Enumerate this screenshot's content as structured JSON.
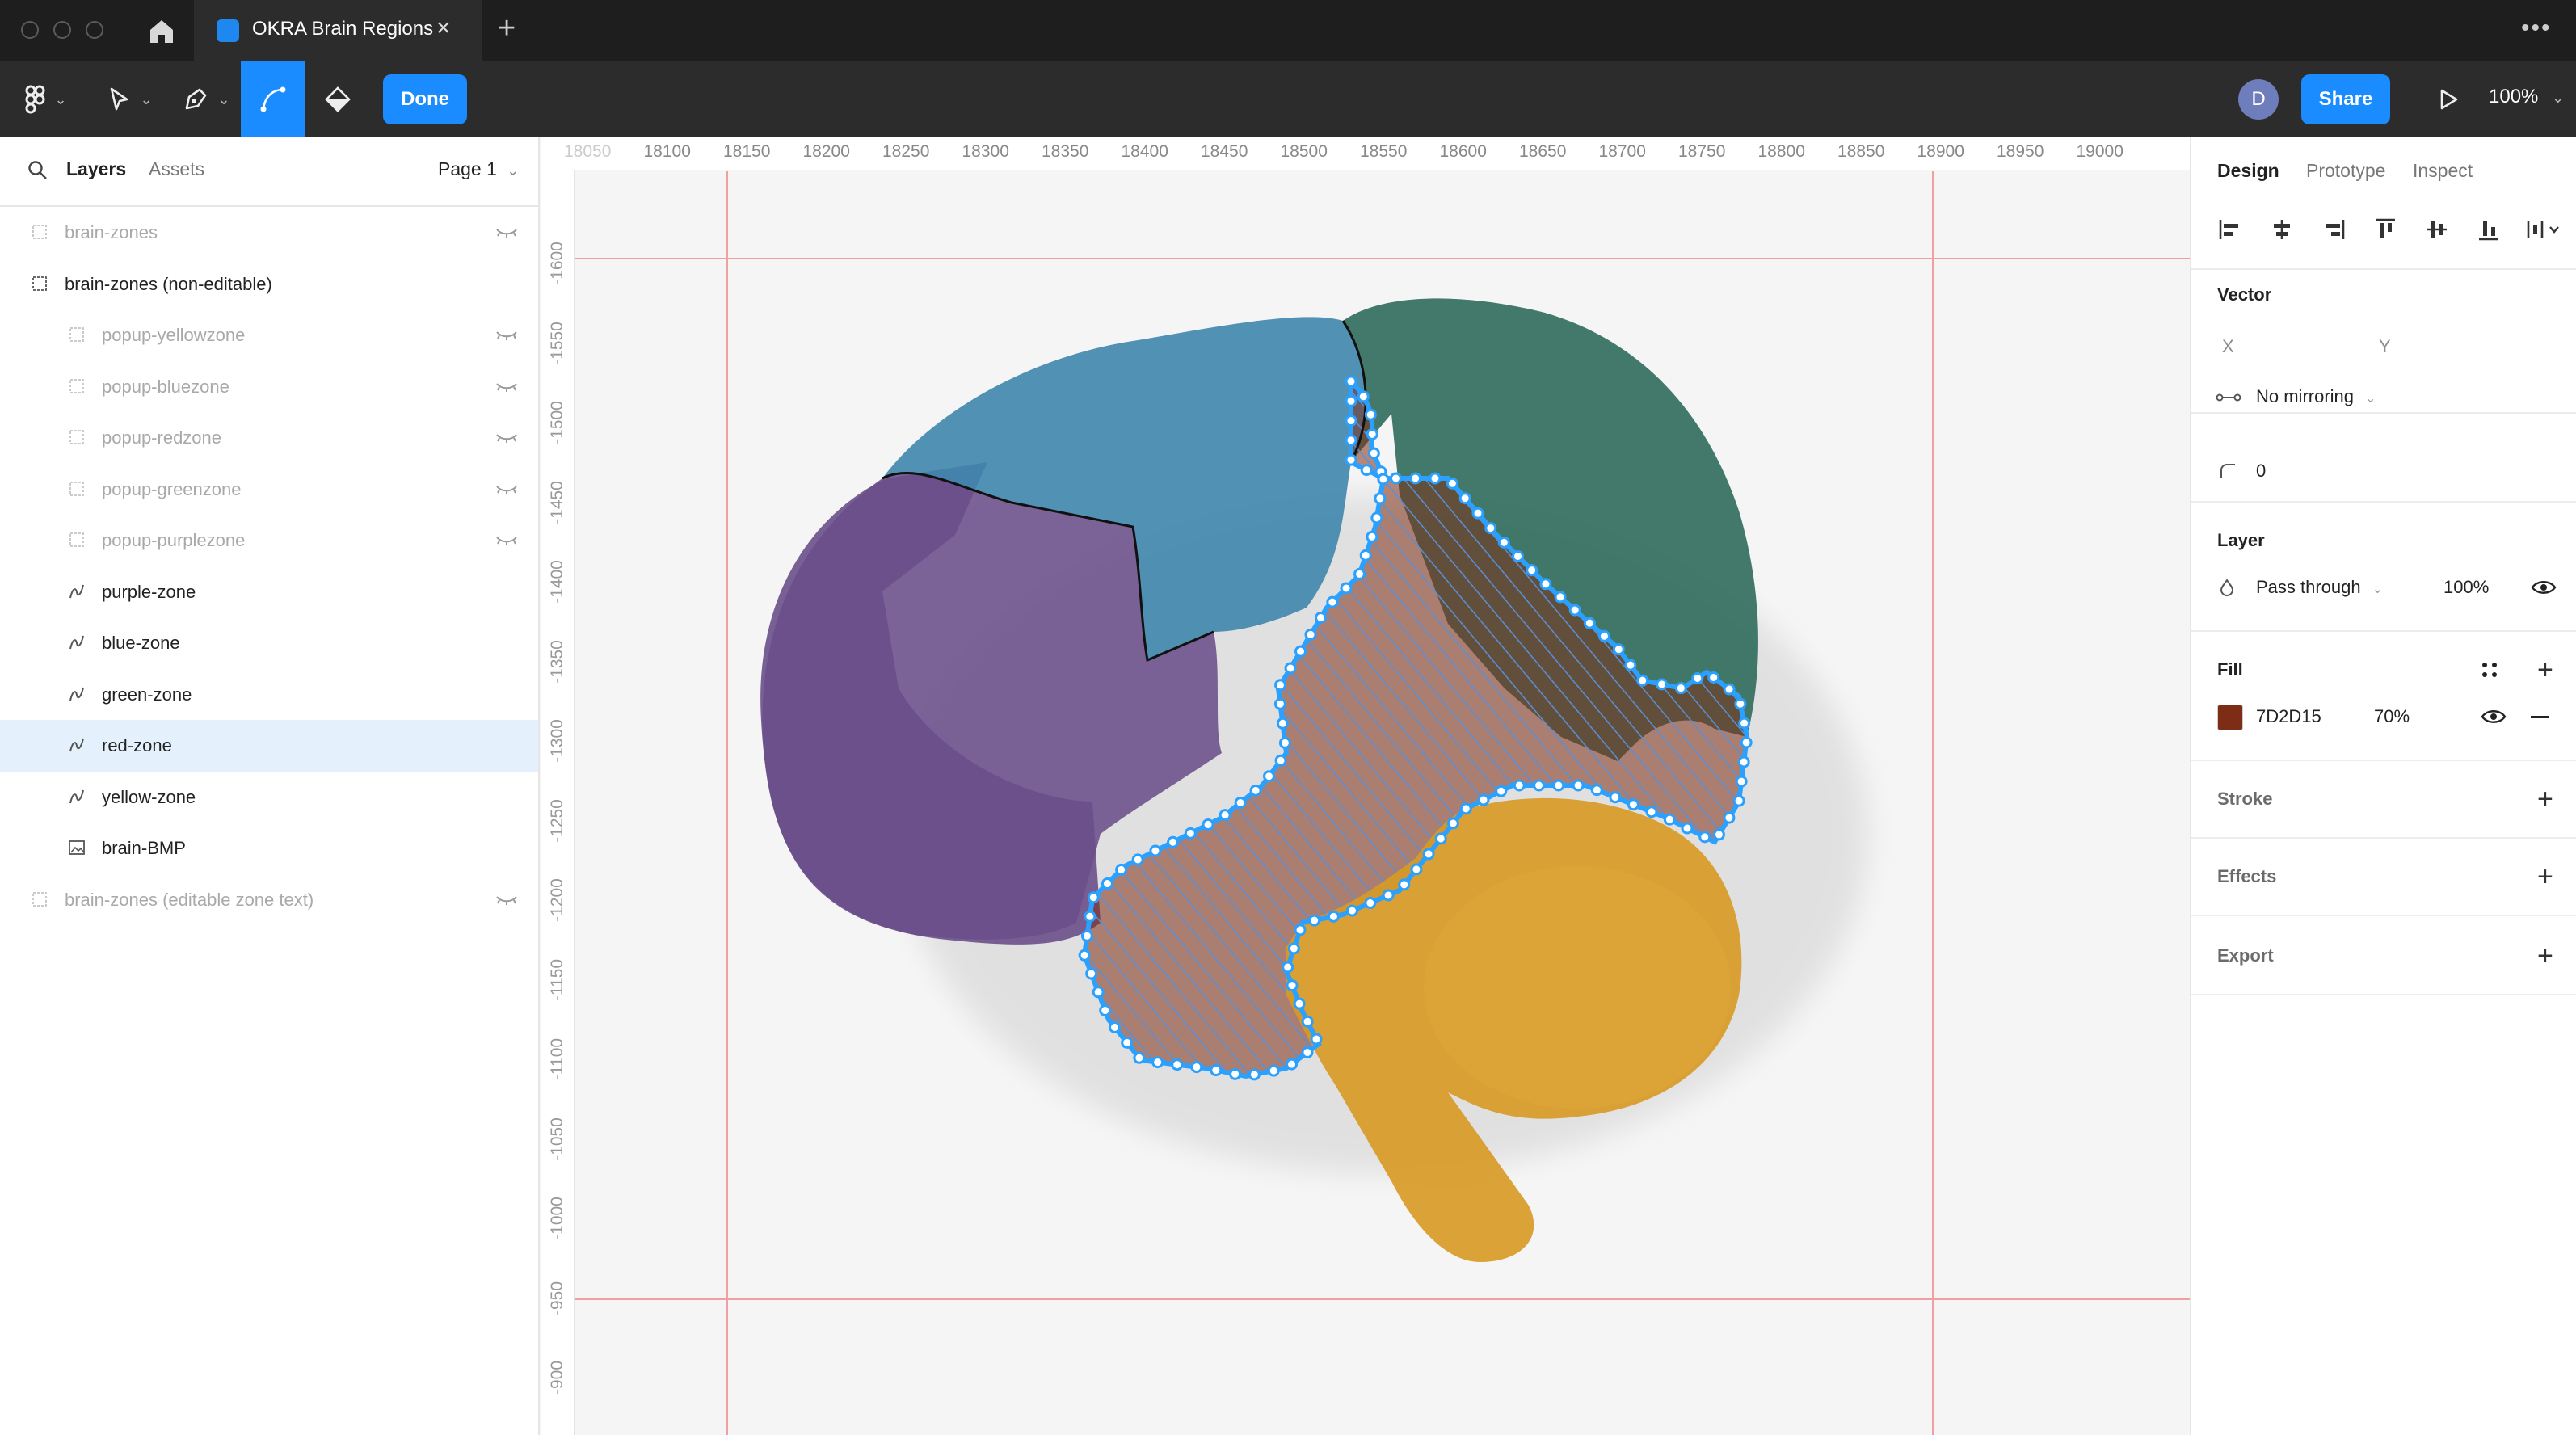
{
  "window": {
    "tab_title": "OKRA Brain Regions",
    "close_glyph": "×",
    "new_tab_glyph": "+",
    "more_glyph": "•••"
  },
  "toolbar": {
    "done_label": "Done",
    "avatar_initial": "D",
    "share_label": "Share",
    "zoom_label": "100%",
    "caret": "⌄"
  },
  "left_panel": {
    "tabs": [
      "Layers",
      "Assets"
    ],
    "page_label": "Page 1",
    "layers": [
      {
        "name": "brain-zones",
        "icon": "frame-icon",
        "hidden": true
      },
      {
        "name": "brain-zones (non-editable)",
        "icon": "frame-icon",
        "hidden": false
      },
      {
        "name": "popup-yellowzone",
        "icon": "frame-icon",
        "hidden": true
      },
      {
        "name": "popup-bluezone",
        "icon": "frame-icon",
        "hidden": true
      },
      {
        "name": "popup-redzone",
        "icon": "frame-icon",
        "hidden": true
      },
      {
        "name": "popup-greenzone",
        "icon": "frame-icon",
        "hidden": true
      },
      {
        "name": "popup-purplezone",
        "icon": "frame-icon",
        "hidden": true
      },
      {
        "name": "purple-zone",
        "icon": "vector-icon",
        "hidden": false
      },
      {
        "name": "blue-zone",
        "icon": "vector-icon",
        "hidden": false
      },
      {
        "name": "green-zone",
        "icon": "vector-icon",
        "hidden": false
      },
      {
        "name": "red-zone",
        "icon": "vector-icon",
        "hidden": false,
        "selected": true
      },
      {
        "name": "yellow-zone",
        "icon": "vector-icon",
        "hidden": false
      },
      {
        "name": "brain-BMP",
        "icon": "image-icon",
        "hidden": false
      },
      {
        "name": "brain-zones (editable zone text)",
        "icon": "frame-icon",
        "hidden": true
      }
    ]
  },
  "rulers": {
    "top": [
      "18050",
      "18100",
      "18150",
      "18200",
      "18250",
      "18300",
      "18350",
      "18400",
      "18450",
      "18500",
      "18550",
      "18600",
      "18650",
      "18700",
      "18750",
      "18800",
      "18850",
      "18900",
      "18950",
      "19000"
    ],
    "left": [
      "-1600",
      "-1550",
      "-1500",
      "-1450",
      "-1400",
      "-1350",
      "-1300",
      "-1250",
      "-1200",
      "-1150",
      "-1100",
      "-1050",
      "-1000",
      "-950",
      "-900"
    ]
  },
  "right_panel": {
    "tabs": [
      "Design",
      "Prototype",
      "Inspect"
    ],
    "vector": {
      "title": "Vector",
      "x_label": "X",
      "y_label": "Y",
      "mirroring": "No mirroring",
      "corner_radius": "0"
    },
    "layer": {
      "title": "Layer",
      "blend": "Pass through",
      "opacity": "100%"
    },
    "fill": {
      "title": "Fill",
      "hex": "7D2D15",
      "opacity": "70%",
      "color": "#7D2D15"
    },
    "stroke_title": "Stroke",
    "effects_title": "Effects",
    "export_title": "Export"
  },
  "canvas": {
    "zone_colors": {
      "purple": "#6a4f8a",
      "blue": "#3f86ad",
      "green": "#2f6b5c",
      "red": "#7D2D15",
      "yellow": "#d79a26"
    }
  },
  "help_glyph": "?"
}
